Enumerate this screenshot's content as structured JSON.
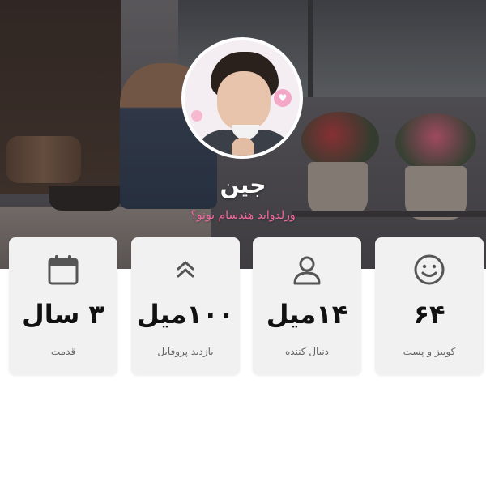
{
  "profile": {
    "name": "جین",
    "bio": "ورلدواید هندسام یونو؟"
  },
  "stats": [
    {
      "icon": "smiley-face-icon",
      "value": "۶۴",
      "label": "کوییز و پست"
    },
    {
      "icon": "user-icon",
      "value": "۱۴میل",
      "label": "دنبال کننده"
    },
    {
      "icon": "double-chevron-up-icon",
      "value": "۱۰۰میل",
      "label": "بازدید پروفایل"
    },
    {
      "icon": "calendar-icon",
      "value": "۳ سال",
      "label": "قدمت"
    }
  ],
  "colors": {
    "card_background": "#f1f1f1",
    "value_text": "#111111",
    "label_text": "#666666",
    "icon": "#555555",
    "bio_text": "#f06aa0"
  }
}
